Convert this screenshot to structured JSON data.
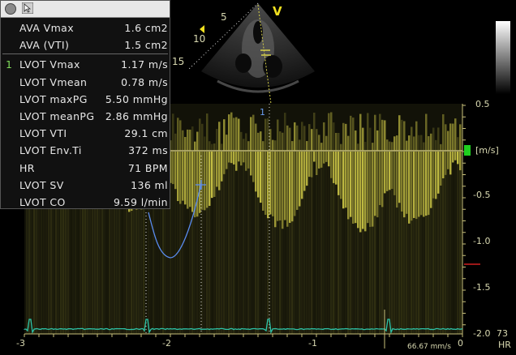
{
  "measurements": [
    {
      "index": "",
      "label": "AVA Vmax",
      "value": "1.6 cm2"
    },
    {
      "index": "",
      "label": "AVA (VTI)",
      "value": "1.5 cm2"
    },
    {
      "index": "1",
      "label": "LVOT Vmax",
      "value": "1.17 m/s"
    },
    {
      "index": "",
      "label": "LVOT Vmean",
      "value": "0.78 m/s"
    },
    {
      "index": "",
      "label": "LVOT maxPG",
      "value": "5.50 mmHg"
    },
    {
      "index": "",
      "label": "LVOT meanPG",
      "value": "2.86 mmHg"
    },
    {
      "index": "",
      "label": "LVOT VTI",
      "value": "29.1 cm"
    },
    {
      "index": "",
      "label": "LVOT Env.Ti",
      "value": "372 ms"
    },
    {
      "index": "",
      "label": "HR",
      "value": "71 BPM"
    },
    {
      "index": "",
      "label": "LVOT SV",
      "value": "136 ml"
    },
    {
      "index": "",
      "label": "LVOT CO",
      "value": "9.59 l/min"
    }
  ],
  "sector": {
    "depth_labels": [
      "5",
      "10",
      "15"
    ],
    "probe_marker": "V",
    "cursor_label": "1"
  },
  "velocity_scale": {
    "unit_label": "[m/s]",
    "ticks": [
      "0.5",
      "-0.5",
      "-1.0",
      "-1.5",
      "-2.0"
    ],
    "hr_value": "73",
    "hr_label": "HR"
  },
  "time_axis": {
    "ticks": [
      "-3",
      "-2",
      "-1",
      "0"
    ],
    "sweep_speed": "66.67 mm/s"
  },
  "colors": {
    "doppler": "#d8d24a",
    "scale_text": "#d8d8b0",
    "ecg": "#2ec4a8",
    "trace": "#5a8cf0",
    "indicator_green": "#1fd01f",
    "marker_red": "#d02020",
    "probe_marker": "#f0e020"
  }
}
